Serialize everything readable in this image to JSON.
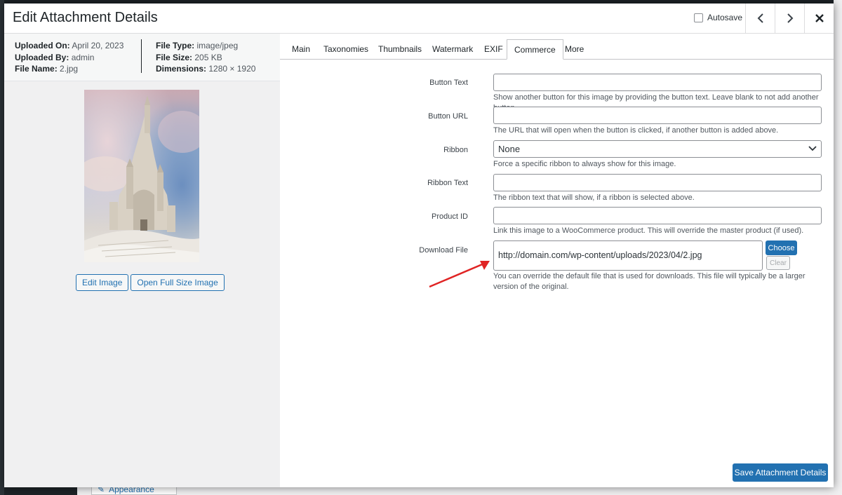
{
  "modal": {
    "title": "Edit Attachment Details",
    "autosave_label": "Autosave"
  },
  "meta": {
    "uploaded_on_label": "Uploaded On:",
    "uploaded_on": "April 20, 2023",
    "uploaded_by_label": "Uploaded By:",
    "uploaded_by": "admin",
    "file_name_label": "File Name:",
    "file_name": "2.jpg",
    "file_type_label": "File Type:",
    "file_type": "image/jpeg",
    "file_size_label": "File Size:",
    "file_size": "205 KB",
    "dimensions_label": "Dimensions:",
    "dimensions": "1280 × 1920"
  },
  "image_buttons": {
    "edit": "Edit Image",
    "open_full": "Open Full Size Image"
  },
  "tabs": [
    "Main",
    "Taxonomies",
    "Thumbnails",
    "Watermark",
    "EXIF",
    "Commerce",
    "More"
  ],
  "active_tab": "Commerce",
  "form": {
    "button_text": {
      "label": "Button Text",
      "value": "",
      "description": "Show another button for this image by providing the button text. Leave blank to not add another button."
    },
    "button_url": {
      "label": "Button URL",
      "value": "",
      "description": "The URL that will open when the button is clicked, if another button is added above."
    },
    "ribbon": {
      "label": "Ribbon",
      "value": "None",
      "description": "Force a specific ribbon to always show for this image."
    },
    "ribbon_text": {
      "label": "Ribbon Text",
      "value": "",
      "description": "The ribbon text that will show, if a ribbon is selected above."
    },
    "product_id": {
      "label": "Product ID",
      "value": "",
      "description": "Link this image to a WooCommerce product. This will override the master product (if used)."
    },
    "download_file": {
      "label": "Download File",
      "value": "http://domain.com/wp-content/uploads/2023/04/2.jpg",
      "choose_label": "Choose",
      "clear_label": "Clear",
      "description": "You can override the default file that is used for downloads. This file will typically be a larger version of the original."
    }
  },
  "footer": {
    "save_label": "Save Attachment Details"
  },
  "background": {
    "appearance_label": "Appearance"
  },
  "colors": {
    "primary": "#2271b1",
    "annotation_arrow": "#e02424"
  }
}
